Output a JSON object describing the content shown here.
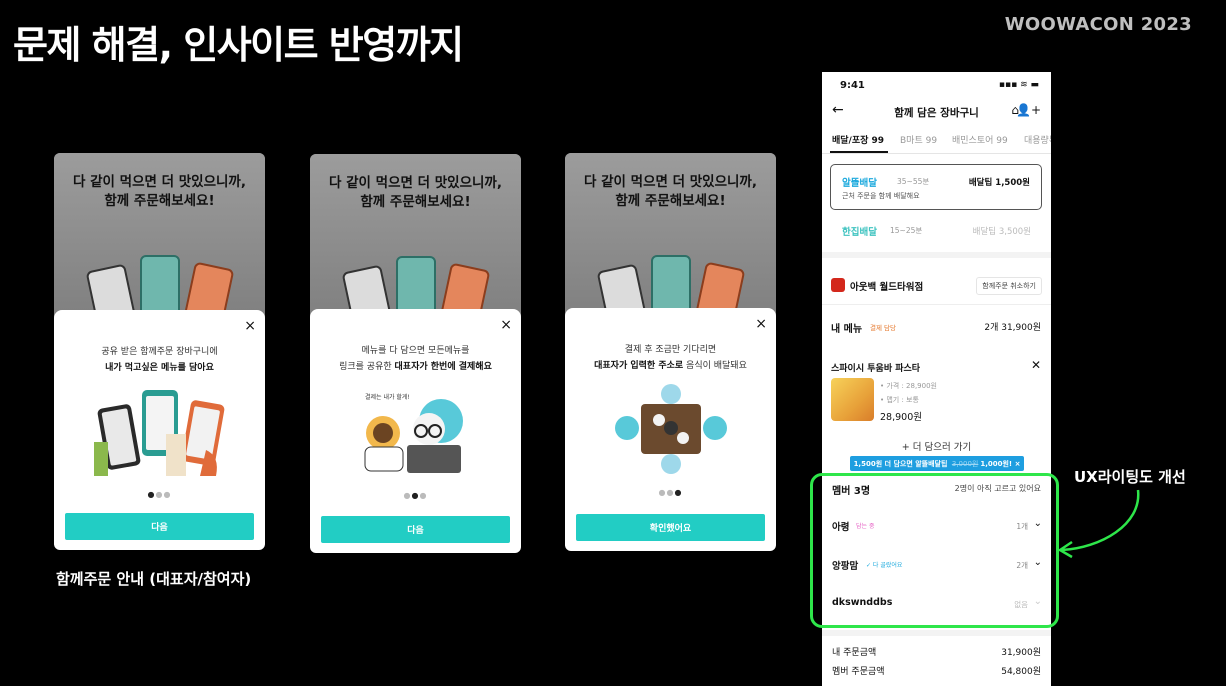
{
  "slide": {
    "title": "문제 해결, 인사이트 반영까지",
    "brand": "WOOWACON 2023",
    "cards_caption": "함께주문 안내 (대표자/참여자)",
    "annotation": "UX라이팅도 개선"
  },
  "cards": [
    {
      "headline": "다 같이 먹으면 더 맛있으니까,\n함께 주문해보세요!",
      "close_icon": "×",
      "desc_line1": "공유 받은 함께주문 장바구니에",
      "desc_line2": "내가 먹고싶은 메뉴를 담아요",
      "dots": {
        "active": 1,
        "total": 3
      },
      "button": "다음"
    },
    {
      "headline": "다 같이 먹으면 더 맛있으니까,\n함께 주문해보세요!",
      "close_icon": "×",
      "desc_line1": "메뉴를 다 담으면 모든메뉴를",
      "desc_line2_prefix": "링크를 공유한 ",
      "desc_line2_bold": "대표자가 한번에 결제해요",
      "illus_text": "결제는 내가 할게!",
      "dots": {
        "active": 2,
        "total": 3
      },
      "button": "다음"
    },
    {
      "headline": "다 같이 먹으면 더 맛있으니까,\n함께 주문해보세요!",
      "close_icon": "×",
      "desc_line1": "결제 후 조금만 기다리면",
      "desc_line2_bold": "대표자가 입력한 주소로",
      "desc_line2_suffix": " 음식이 배달돼요",
      "dots": {
        "active": 3,
        "total": 3
      },
      "button": "확인했어요"
    }
  ],
  "phone": {
    "status_time": "9:41",
    "status_icons": "▪▪▪ ≋ ▬",
    "nav_title": "함께 담은 장바구니",
    "back_icon": "←",
    "home_icon": "⌂",
    "share_icon": "👤+",
    "tabs": [
      "배달/포장 99",
      "B마트 99",
      "배민스토어 99",
      "대용량특가"
    ],
    "delivery_option_1": {
      "name": "알뜰배달",
      "time": "35~55분",
      "fee": "배달팁 1,500원",
      "sub": "근처 주문을 함께 배달해요"
    },
    "delivery_option_2": {
      "name": "한집배달",
      "time": "15~25분",
      "fee": "배달팁 3,500원"
    },
    "store": {
      "name": "아웃백 월드타워점",
      "cancel_button": "함께주문 취소하기"
    },
    "my_menu": {
      "label": "내 메뉴",
      "badge": "결제 담당",
      "total": "2개 31,900원"
    },
    "item": {
      "name": "스파이시 투움바 파스타",
      "opt1": "• 가격 : 28,900원",
      "opt2": "• 맵기 : 보통",
      "price": "28,900원"
    },
    "add_more": "+ 더 담으러 가기",
    "promo": {
      "prefix": "1,500원 더 담으면 알뜰배달팁",
      "old": "3,000원",
      "new": "1,000원!",
      "close": "×"
    },
    "members": {
      "title": "멤버 3명",
      "waiting": "2명이 아직 고르고 있어요",
      "list": [
        {
          "name": "아령",
          "badge": "담는 중",
          "badge_color": "#e55fc4",
          "count": "1개"
        },
        {
          "name": "앙팡맘",
          "badge": "✓ 다 골랐어요",
          "badge_color": "#1ca9dd",
          "count": "2개"
        },
        {
          "name": "dkswnddbs",
          "badge": "",
          "badge_color": "#999999",
          "count": "없음"
        }
      ]
    },
    "summary": [
      {
        "label": "내 주문금액",
        "value": "31,900원"
      },
      {
        "label": "멤버 주문금액",
        "value": "54,800원"
      }
    ]
  },
  "colors": {
    "accent_teal": "#22cdc4",
    "highlight_green": "#2ee64a",
    "promo_blue": "#1e9ee0"
  }
}
